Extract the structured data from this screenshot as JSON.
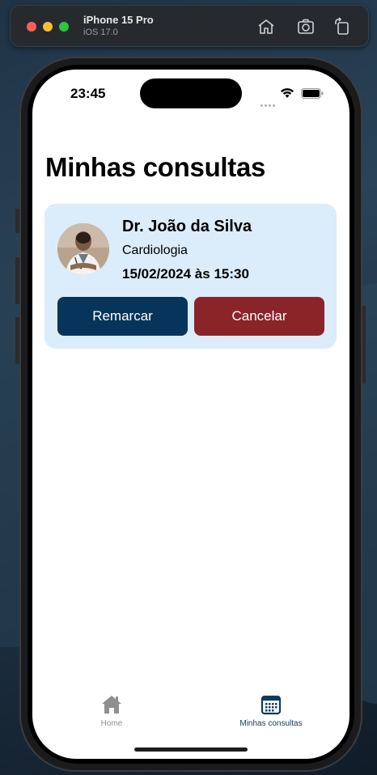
{
  "simulator": {
    "device": "iPhone 15 Pro",
    "os": "iOS 17.0",
    "icons": [
      "home-icon",
      "screenshot-icon",
      "rotate-icon"
    ]
  },
  "status_bar": {
    "time": "23:45",
    "icons": [
      "signal-icon",
      "wifi-icon",
      "battery-icon"
    ]
  },
  "page": {
    "title": "Minhas consultas"
  },
  "appointment": {
    "doctor": "Dr. João da Silva",
    "specialty": "Cardiologia",
    "datetime": "15/02/2024 às 15:30",
    "reschedule_label": "Remarcar",
    "cancel_label": "Cancelar"
  },
  "tabbar": {
    "items": [
      {
        "label": "Home",
        "icon": "home-icon",
        "active": false
      },
      {
        "label": "Minhas consultas",
        "icon": "calendar-icon",
        "active": true
      }
    ]
  },
  "colors": {
    "card_bg": "#dbecfb",
    "reschedule_bg": "#07345a",
    "cancel_bg": "#8a2429",
    "tab_active": "#0d3b5e",
    "tab_inactive": "#8e8e93"
  }
}
